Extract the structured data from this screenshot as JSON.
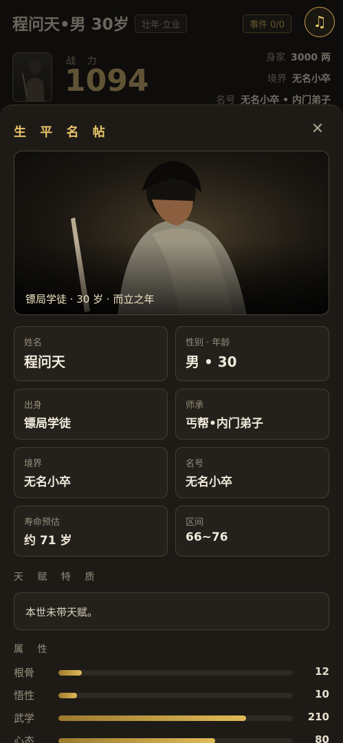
{
  "header": {
    "name_line": "程问天•男 30岁",
    "phase_badge": "壮年·立业",
    "events_badge": "事件 0/0",
    "music_icon": "music-note-icon",
    "power_label": "战 力",
    "power_value": "1094",
    "wealth_label": "身家",
    "wealth_value": "3000 两",
    "realm_label": "境界",
    "realm_value": "无名小卒",
    "title_label": "名号",
    "title_value": "无名小卒 • 内门弟子"
  },
  "sheet": {
    "title": "生 平 名 帖",
    "close_icon": "✕",
    "hero_caption": "镖局学徒 · 30 岁 · 而立之年",
    "cards": [
      {
        "label": "姓名",
        "value": "程问天"
      },
      {
        "label": "性别 · 年龄",
        "value": "男 • 30"
      },
      {
        "label": "出身",
        "value": "镖局学徒"
      },
      {
        "label": "师承",
        "value": "丐帮•内门弟子"
      },
      {
        "label": "境界",
        "value": "无名小卒"
      },
      {
        "label": "名号",
        "value": "无名小卒"
      },
      {
        "label": "寿命预估",
        "value": "约 71 岁"
      },
      {
        "label": "区间",
        "value": "66~76"
      }
    ],
    "talent_label": "天 赋 特 质",
    "talent_text": "本世未带天赋。",
    "attrs_label": "属 性",
    "attrs": [
      {
        "name": "根骨",
        "value": "12",
        "fill": 0.1
      },
      {
        "name": "悟性",
        "value": "10",
        "fill": 0.08
      },
      {
        "name": "武学",
        "value": "210",
        "fill": 0.8
      },
      {
        "name": "心态",
        "value": "80",
        "fill": 0.67
      }
    ]
  },
  "colors": {
    "accent_gold": "#e8c46a",
    "sheet_bg": "#1e1b17",
    "card_bg": "#24211c"
  }
}
